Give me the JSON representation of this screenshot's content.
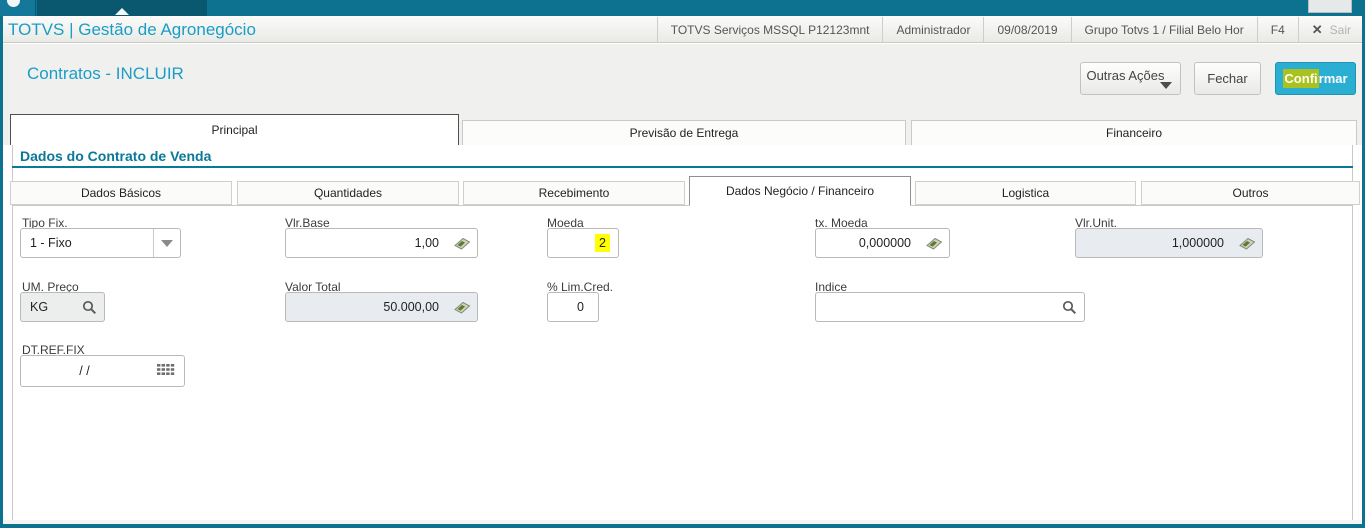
{
  "window": {
    "app_title": "TOTVS | Gestão de Agronegócio",
    "top_right_items": [
      "TOTVS Serviços MSSQL P12123mnt",
      "Administrador",
      "09/08/2019",
      "Grupo Totvs 1 / Filial Belo Hor",
      "F4"
    ],
    "close_icon": "✕",
    "close_label": "Sair"
  },
  "page": {
    "title": "Contratos - INCLUIR",
    "actions": {
      "outras_acoes": "Outras Ações",
      "fechar": "Fechar",
      "confirmar_highlighted": "Confi",
      "confirmar_rest": "rmar"
    }
  },
  "main_tabs": [
    {
      "label": "Principal",
      "active": true
    },
    {
      "label": "Previsão de Entrega",
      "active": false
    },
    {
      "label": "Financeiro",
      "active": false
    }
  ],
  "section_title": "Dados do Contrato de Venda",
  "sub_tabs": [
    {
      "label": "Dados Básicos",
      "active": false
    },
    {
      "label": "Quantidades",
      "active": false
    },
    {
      "label": "Recebimento",
      "active": false
    },
    {
      "label": "Dados Negócio / Financeiro",
      "active": true
    },
    {
      "label": "Logistica",
      "active": false
    },
    {
      "label": "Outros",
      "active": false
    }
  ],
  "fields": {
    "tipo_fix": {
      "label": "Tipo Fix.",
      "value": "1 - Fixo"
    },
    "vlr_base": {
      "label": "Vlr.Base",
      "value": "1,00"
    },
    "moeda": {
      "label": "Moeda",
      "value": "2",
      "highlighted": true
    },
    "tx_moeda": {
      "label": "tx. Moeda",
      "value": "0,000000"
    },
    "vlr_unit": {
      "label": "Vlr.Unit.",
      "value": "1,000000"
    },
    "um_preco": {
      "label": "UM. Preço",
      "value": "KG"
    },
    "valor_total": {
      "label": "Valor Total",
      "value": "50.000,00"
    },
    "lim_cred": {
      "label": "% Lim.Cred.",
      "value": "0"
    },
    "indice": {
      "label": "Indice",
      "value": ""
    },
    "dt_ref_fix": {
      "label": "DT.REF.FIX",
      "value": "/ /"
    }
  },
  "colors": {
    "topbar_teal": "#0d7190",
    "accent_teal": "#1b9dc6",
    "section_teal": "#0a7897",
    "confirm_button": "#2aaed2",
    "field_highlight": "#ffff00",
    "confirm_highlight": "#a9c21f",
    "disabled_field": "#e8ecf1"
  }
}
